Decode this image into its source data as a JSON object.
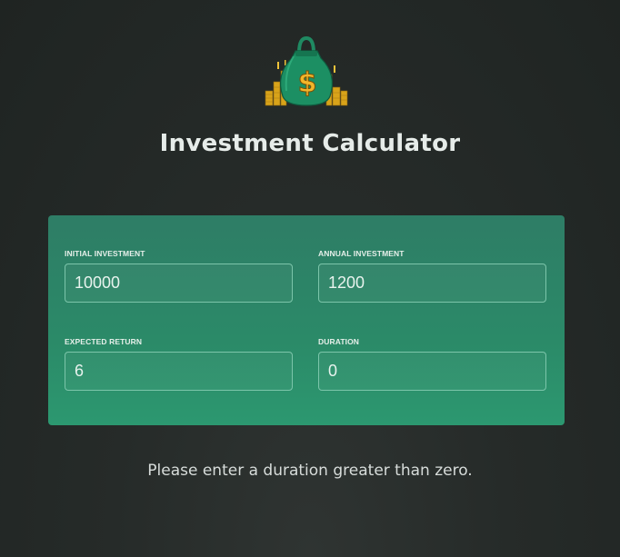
{
  "header": {
    "logo_icon": "money-bag-icon",
    "title": "Investment Calculator"
  },
  "form": {
    "initial_investment": {
      "label": "INITIAL INVESTMENT",
      "value": "10000"
    },
    "annual_investment": {
      "label": "ANNUAL INVESTMENT",
      "value": "1200"
    },
    "expected_return": {
      "label": "EXPECTED RETURN",
      "value": "6"
    },
    "duration": {
      "label": "DURATION",
      "value": "0"
    }
  },
  "message": "Please enter a duration greater than zero.",
  "colors": {
    "background": "#262b29",
    "panel": "#2b8a68",
    "input_border": "#7cc5aa",
    "title": "#e6ece9",
    "gold": "#e0a81c"
  }
}
